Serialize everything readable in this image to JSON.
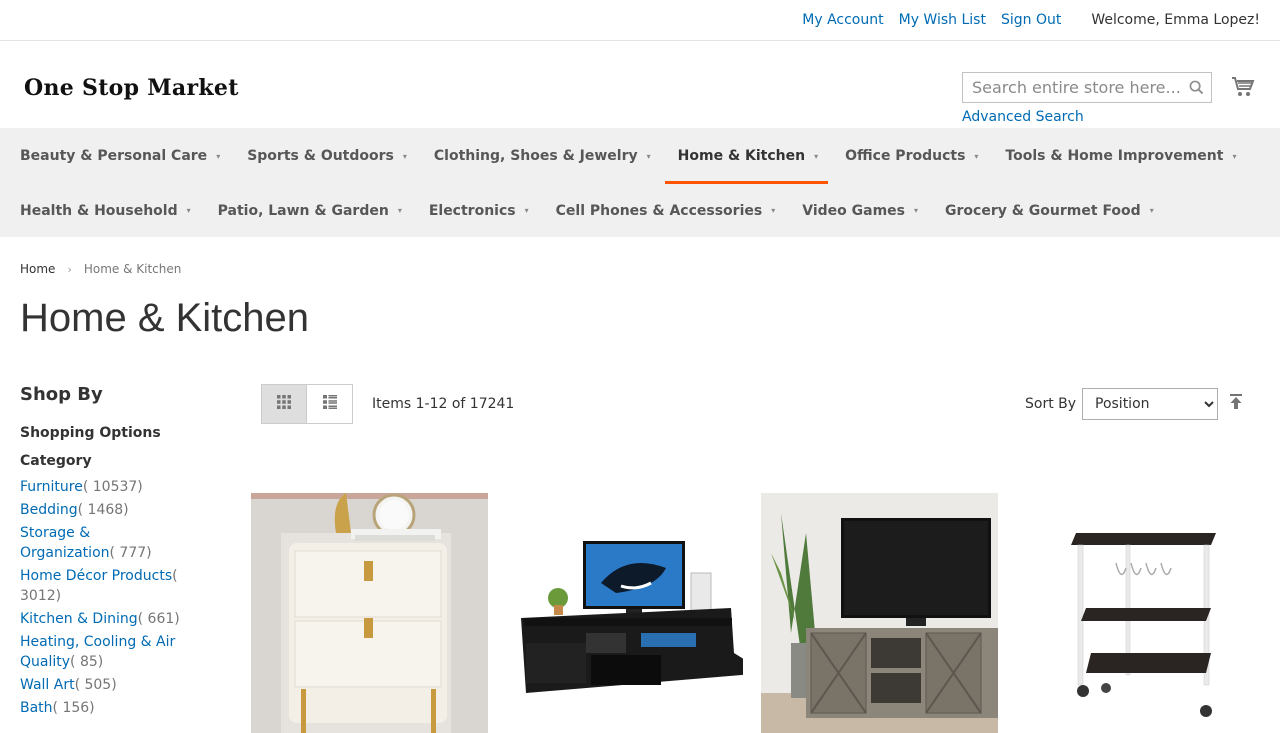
{
  "topbar": {
    "my_account": "My Account",
    "wish_list": "My Wish List",
    "sign_out": "Sign Out",
    "welcome": "Welcome, Emma Lopez!"
  },
  "header": {
    "logo_text": "One Stop Market",
    "search_placeholder": "Search entire store here...",
    "advanced_search": "Advanced Search"
  },
  "nav": {
    "row1": [
      {
        "label": "Beauty & Personal Care"
      },
      {
        "label": "Sports & Outdoors"
      },
      {
        "label": "Clothing, Shoes & Jewelry"
      },
      {
        "label": "Home & Kitchen"
      },
      {
        "label": "Office Products"
      },
      {
        "label": "Tools & Home Improvement"
      }
    ],
    "row2": [
      {
        "label": "Health & Household"
      },
      {
        "label": "Patio, Lawn & Garden"
      },
      {
        "label": "Electronics"
      },
      {
        "label": "Cell Phones & Accessories"
      },
      {
        "label": "Video Games"
      },
      {
        "label": "Grocery & Gourmet Food"
      }
    ]
  },
  "breadcrumb": {
    "home": "Home",
    "current": "Home & Kitchen"
  },
  "page_title": "Home & Kitchen",
  "sidebar": {
    "shop_by": "Shop By",
    "shopping_options": "Shopping Options",
    "category_title": "Category",
    "categories": [
      {
        "name": "Furniture",
        "count": "( 10537)"
      },
      {
        "name": "Bedding",
        "count": "( 1468)"
      },
      {
        "name": "Storage & Organization",
        "count": "( 777)"
      },
      {
        "name": "Home Décor Products",
        "count": "( 3012)"
      },
      {
        "name": "Kitchen & Dining",
        "count": "( 661)"
      },
      {
        "name": "Heating, Cooling & Air Quality",
        "count": "( 85)"
      },
      {
        "name": "Wall Art",
        "count": "( 505)"
      },
      {
        "name": "Bath",
        "count": "( 156)"
      }
    ]
  },
  "toolbar": {
    "amount": "Items 1-12 of 17241",
    "sort_by_label": "Sort By",
    "sort_selected": "Position"
  },
  "colors": {
    "link": "#006bb4",
    "active_nav_underline": "#ff5501",
    "nav_bg": "#f0f0f0"
  }
}
